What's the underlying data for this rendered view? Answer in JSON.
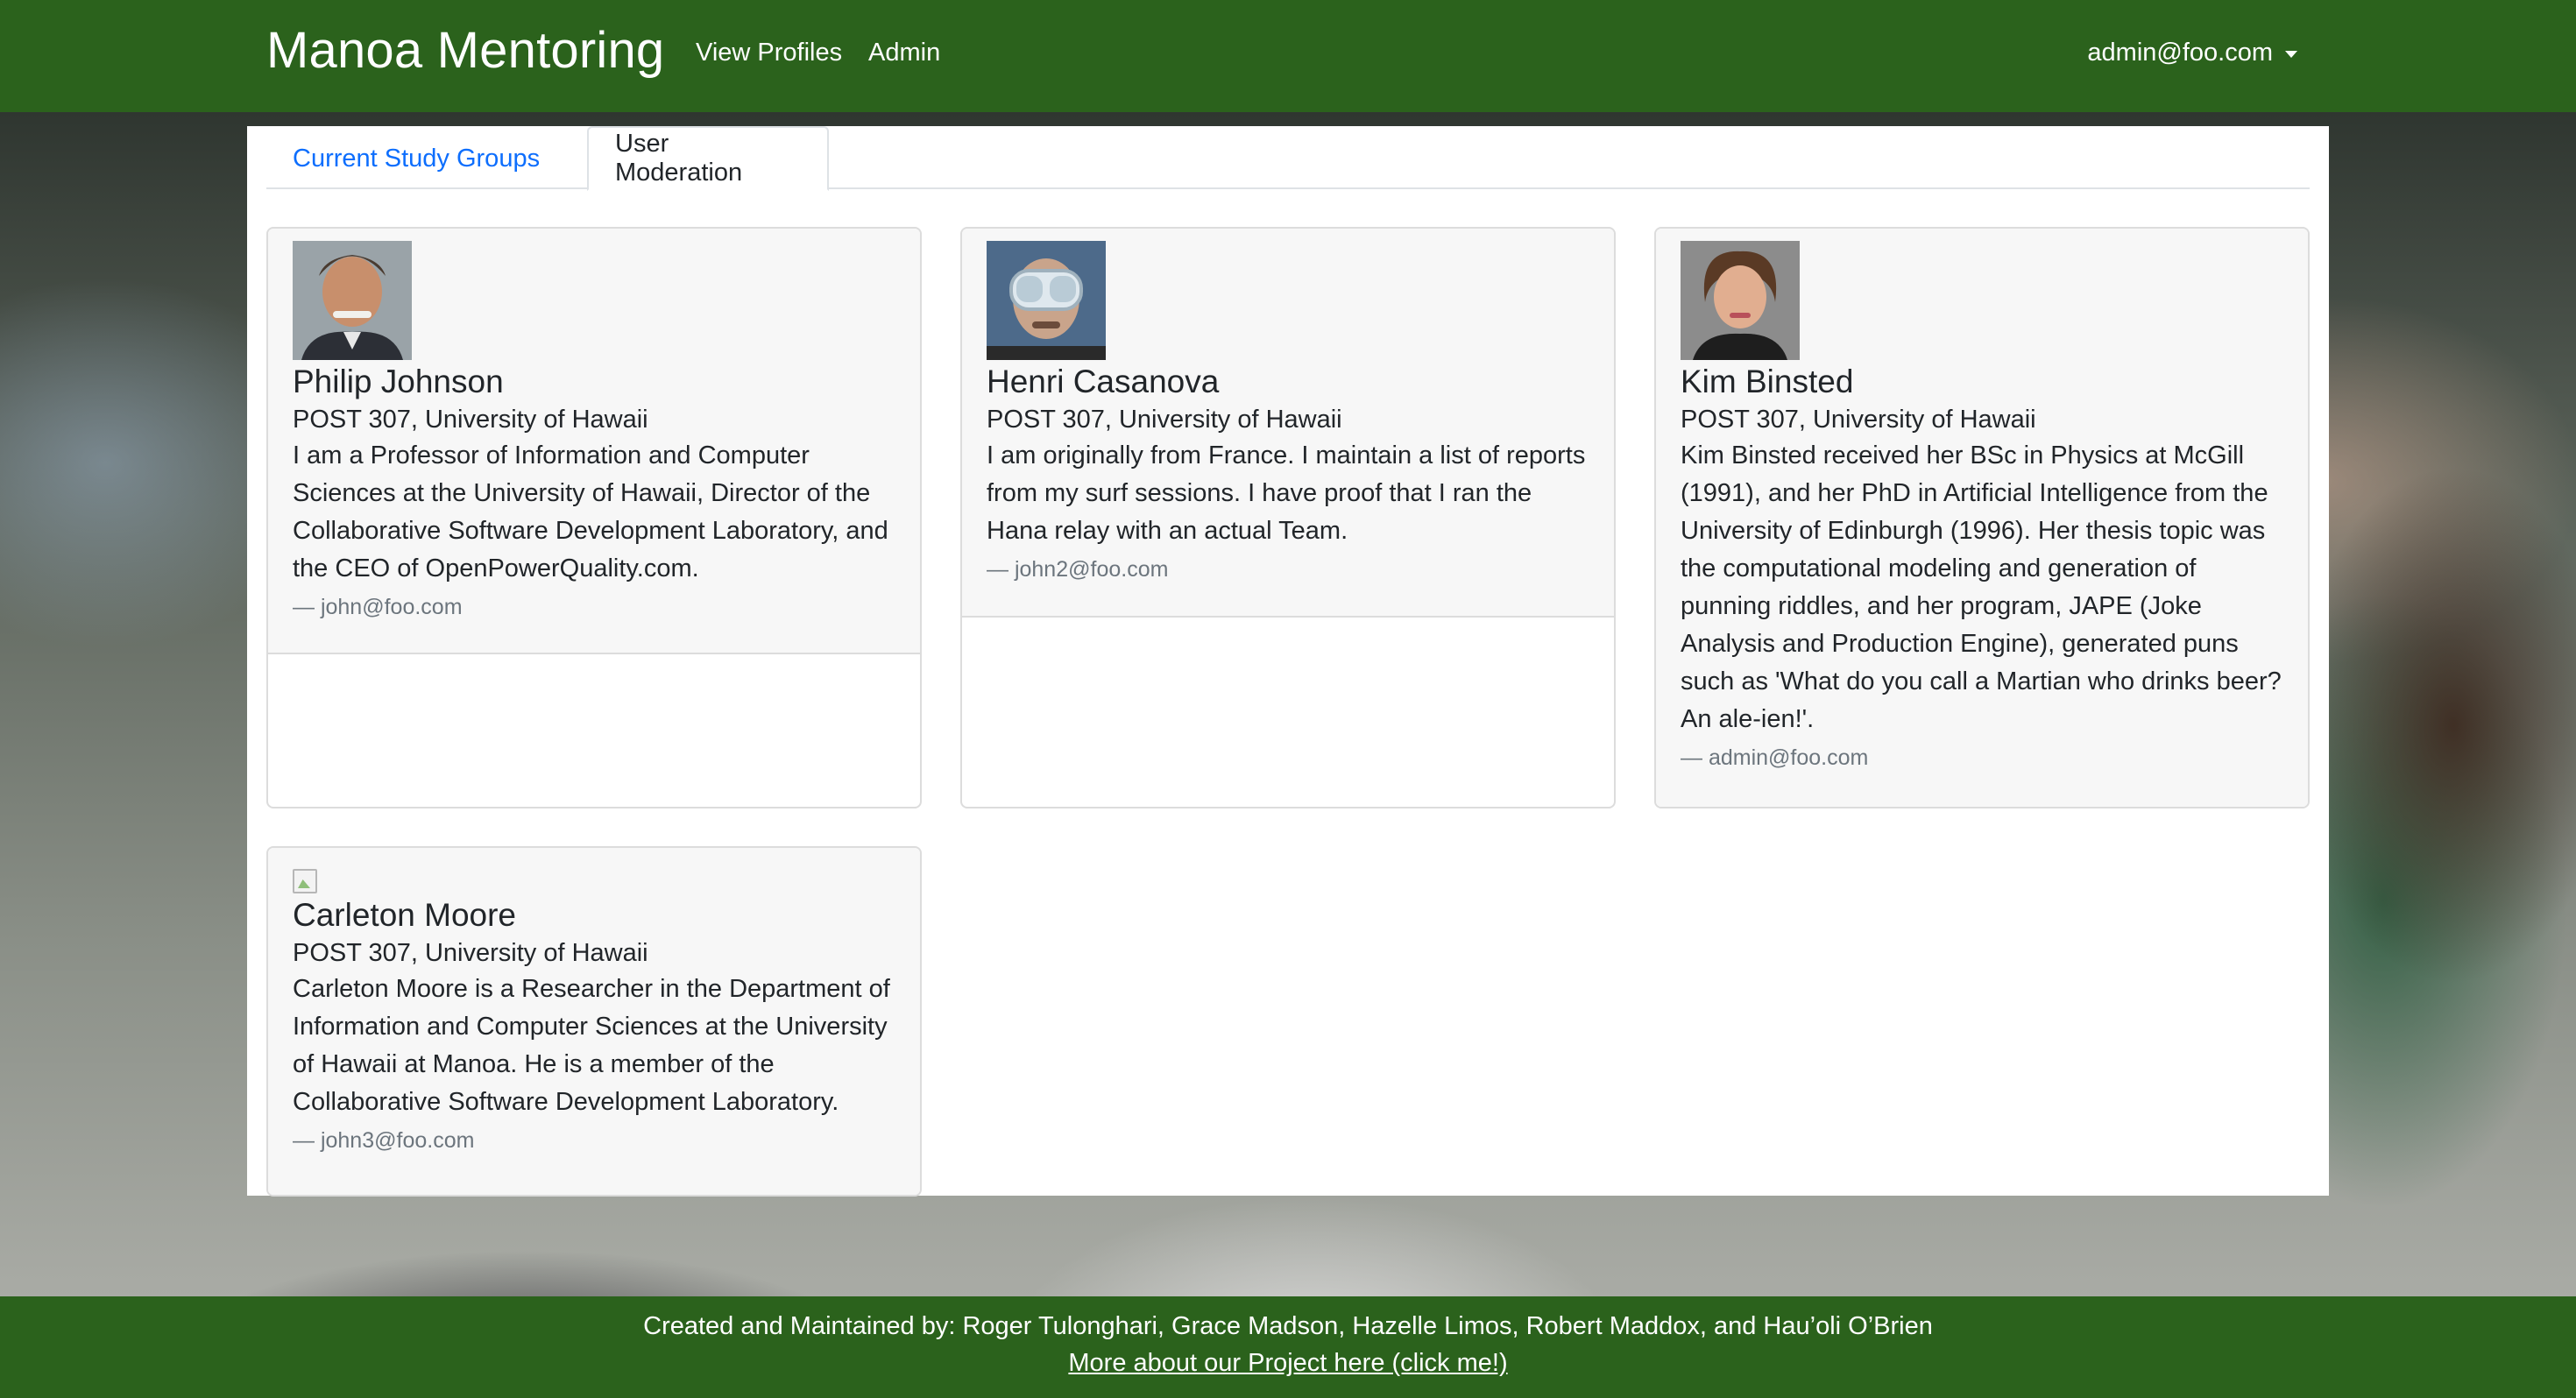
{
  "navbar": {
    "brand": "Manoa Mentoring",
    "links": [
      "View Profiles",
      "Admin"
    ],
    "user": "admin@foo.com",
    "background_color": "#2b621c"
  },
  "tabs": [
    {
      "label": "Current Study Groups",
      "active": false
    },
    {
      "label": "User Moderation",
      "active": true
    }
  ],
  "profiles": [
    {
      "name": "Philip Johnson",
      "location": "POST 307, University of Hawaii",
      "bio": "I am a Professor of Information and Computer Sciences at the University of Hawaii, Director of the Collaborative Software Development Laboratory, and the CEO of OpenPowerQuality.com.",
      "email": "— john@foo.com",
      "avatar": "portrait-photo"
    },
    {
      "name": "Henri Casanova",
      "location": "POST 307, University of Hawaii",
      "bio": "I am originally from France. I maintain a list of reports from my surf sessions. I have proof that I ran the Hana relay with an actual Team.",
      "email": "— john2@foo.com",
      "avatar": "portrait-photo-goggles"
    },
    {
      "name": "Kim Binsted",
      "location": "POST 307, University of Hawaii",
      "bio": "Kim Binsted received her BSc in Physics at McGill (1991), and her PhD in Artificial Intelligence from the University of Edinburgh (1996). Her thesis topic was the computational modeling and generation of punning riddles, and her program, JAPE (Joke Analysis and Production Engine), generated puns such as 'What do you call a Martian who drinks beer? An ale-ien!'.",
      "email": "— admin@foo.com",
      "avatar": "portrait-photo"
    },
    {
      "name": "Carleton Moore",
      "location": "POST 307, University of Hawaii",
      "bio": "Carleton Moore is a Researcher in the Department of Information and Computer Sciences at the University of Hawaii at Manoa. He is a member of the Collaborative Software Development Laboratory.",
      "email": "— john3@foo.com",
      "avatar": "broken-image-icon"
    }
  ],
  "footer": {
    "credits": "Created and Maintained by: Roger Tulonghari, Grace Madson, Hazelle Limos, Robert Maddox, and Hau’oli O’Brien",
    "link": "More about our Project here (click me!)"
  }
}
